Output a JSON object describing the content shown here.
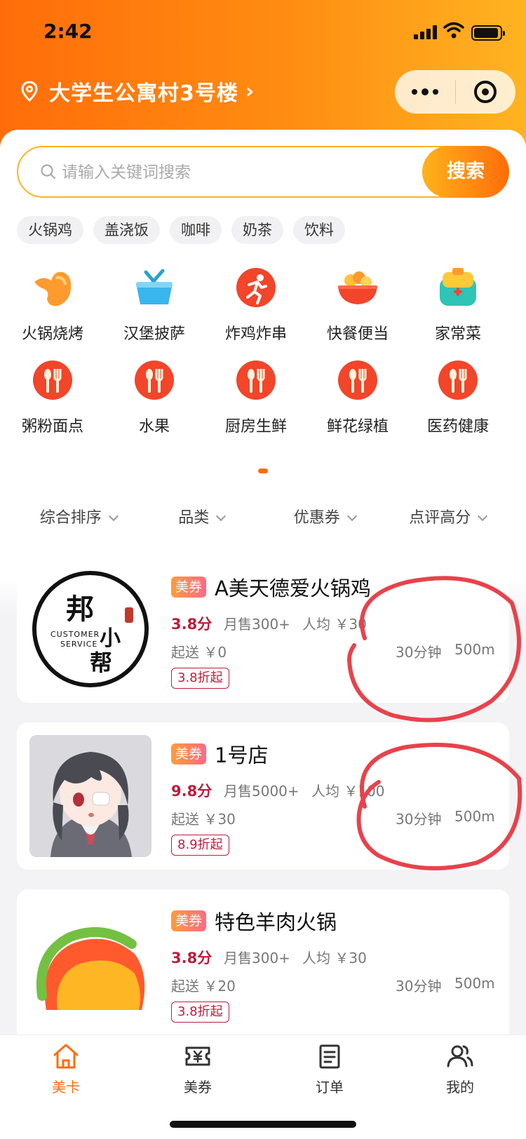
{
  "status_bar": {
    "time": "2:42"
  },
  "header": {
    "location": "大学生公寓村3号楼",
    "location_chevron": "›",
    "gradient": [
      "#ff6d0a",
      "#ffb321"
    ]
  },
  "search": {
    "placeholder": "请输入关键词搜索",
    "button": "搜索"
  },
  "chips": [
    "火锅鸡",
    "盖浇饭",
    "咖啡",
    "奶茶",
    "饮料"
  ],
  "categories": [
    {
      "label": "火锅烧烤",
      "icon": "duck-icon"
    },
    {
      "label": "汉堡披萨",
      "icon": "basket-icon"
    },
    {
      "label": "炸鸡炸串",
      "icon": "runner-icon"
    },
    {
      "label": "快餐便当",
      "icon": "bowl-icon"
    },
    {
      "label": "家常菜",
      "icon": "lunchbox-icon"
    },
    {
      "label": "粥粉面点",
      "icon": "utensils-icon"
    },
    {
      "label": "水果",
      "icon": "utensils-icon"
    },
    {
      "label": "厨房生鲜",
      "icon": "utensils-icon"
    },
    {
      "label": "鲜花绿植",
      "icon": "utensils-icon"
    },
    {
      "label": "医药健康",
      "icon": "utensils-icon"
    }
  ],
  "filters": [
    "综合排序",
    "品类",
    "优惠券",
    "点评高分"
  ],
  "stores": [
    {
      "badge": "美券",
      "name": "A美天德爱火锅鸡",
      "score": "3.8分",
      "sales": "月售300+",
      "avg": "人均 ￥30",
      "min_order": "起送 ￥0",
      "eta": "30分钟",
      "distance": "500m",
      "discount": "3.8折起",
      "logo": {
        "big": "邦",
        "line1": "CUSTOMER",
        "line2": "SERVICE",
        "small1": "小",
        "small2": "帮"
      }
    },
    {
      "badge": "美券",
      "name": "1号店",
      "score": "9.8分",
      "sales": "月售5000+",
      "avg": "人均 ￥100",
      "min_order": "起送 ￥30",
      "eta": "30分钟",
      "distance": "500m",
      "discount": "8.9折起"
    },
    {
      "badge": "美券",
      "name": "特色羊肉火锅",
      "score": "3.8分",
      "sales": "月售300+",
      "avg": "人均 ￥30",
      "min_order": "起送 ￥20",
      "eta": "30分钟",
      "distance": "500m",
      "discount": "3.8折起"
    }
  ],
  "tabs": [
    {
      "label": "美卡",
      "icon": "home-icon",
      "active": true
    },
    {
      "label": "美券",
      "icon": "coupon-icon",
      "active": false
    },
    {
      "label": "订单",
      "icon": "order-list-icon",
      "active": false
    },
    {
      "label": "我的",
      "icon": "users-icon",
      "active": false
    }
  ],
  "colors": {
    "accent": "#ff6d0a",
    "price_red": "#c01b3a",
    "annotation": "#e8424b"
  }
}
